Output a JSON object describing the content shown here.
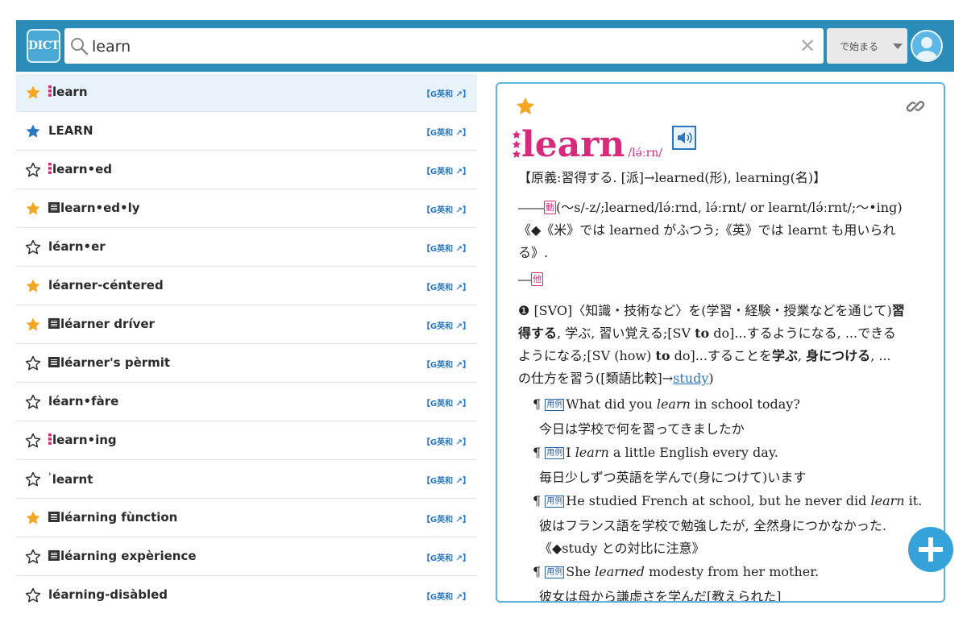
{
  "header": {
    "logo_text": "DICT",
    "search": {
      "value": "learn",
      "placeholder": ""
    },
    "clear_icon": "close-icon",
    "mode_select": {
      "selected": "で始まる"
    },
    "colors": {
      "bar": "#2a8cb7",
      "accent": "#35a3da",
      "star_orange": "#f5a623",
      "star_blue": "#2b78c2",
      "headword": "#d62a7c"
    }
  },
  "word_list": {
    "dict_badge": "【G英和 ↗】",
    "items": [
      {
        "mark": "dots",
        "word": "learn",
        "star": "orange",
        "selected": true
      },
      {
        "mark": "",
        "word": "LEARN",
        "star": "blue",
        "selected": false
      },
      {
        "mark": "dots",
        "word": "learn•ed",
        "star": "outline",
        "selected": false
      },
      {
        "mark": "box",
        "word": "learn•ed•ly",
        "star": "orange",
        "selected": false
      },
      {
        "mark": "",
        "word": "léarn•er",
        "star": "outline",
        "selected": false
      },
      {
        "mark": "",
        "word": "léarner-céntered",
        "star": "orange",
        "selected": false
      },
      {
        "mark": "box",
        "word": "léarner dríver",
        "star": "orange",
        "selected": false
      },
      {
        "mark": "box",
        "word": "léarner's pèrmit",
        "star": "outline",
        "selected": false
      },
      {
        "mark": "",
        "word": "léarn•fàre",
        "star": "outline",
        "selected": false
      },
      {
        "mark": "dots",
        "word": "learn•ing",
        "star": "outline",
        "selected": false
      },
      {
        "mark": "tick",
        "word": "learnt",
        "star": "outline",
        "selected": false
      },
      {
        "mark": "box",
        "word": "léarning fùnction",
        "star": "orange",
        "selected": false
      },
      {
        "mark": "box",
        "word": "léarning expèrience",
        "star": "outline",
        "selected": false
      },
      {
        "mark": "",
        "word": "léarning-disàbled",
        "star": "outline",
        "selected": false
      }
    ]
  },
  "entry": {
    "headword": "learn",
    "pronunciation": "/lə́ːrn/",
    "etymology": "【原義:習得する. [派]→learned(形), learning(名)】",
    "inflection_dash": "――",
    "pos_verb": "動",
    "inflection": "(〜s/-z/;learned/lə́ːrnd, lə́ːrnt/ or learnt/lə́ːrnt/;〜•ing)",
    "usage_note_1": "《◆《米》では learned がふつう;《英》では learnt も用いられ",
    "usage_note_2": "る》.",
    "pos_trans_dash": "―",
    "pos_trans": "他",
    "sense": {
      "number": "❶",
      "l1_a": "[SVO]〈知識・技術など〉を(学習・経験・授業などを通じて)",
      "l1_b": "習",
      "l2_a": "得する",
      "l2_b": ", 学ぶ, 習い覚える;[SV ",
      "l2_c": "to",
      "l2_d": " do]...するようになる, ...できる",
      "l3_a": "ようになる;[SV (how) ",
      "l3_b": "to",
      "l3_c": " do]...することを",
      "l3_d": "学ぶ",
      "l3_e": ", ",
      "l3_f": "身につける",
      "l3_g": ", ...",
      "l4_a": "の仕方を習う([類語比較]→",
      "l4_link": "study",
      "l4_b": ")"
    },
    "example_mark": "¶",
    "example_tag": "用例",
    "examples": [
      {
        "pre": "What did you ",
        "kw": "learn",
        "post": " in school today?",
        "ja": "今日は学校で何を習ってきましたか",
        "note": ""
      },
      {
        "pre": "I ",
        "kw": "learn",
        "post": " a little English every day.",
        "ja": "毎日少しずつ英語を学んで(身につけて)います",
        "note": ""
      },
      {
        "pre": "He studied French at school, but he never did ",
        "kw": "learn",
        "post": " it.",
        "ja": "彼はフランス語を学校で勉強したが, 全然身につかなかった.",
        "note": "《◆study との対比に注意》"
      },
      {
        "pre": "She ",
        "kw": "learned",
        "post": " modesty from her mother.",
        "ja": "彼女は母から謙虚さを学んだ[教えられた]",
        "note": ""
      }
    ]
  }
}
